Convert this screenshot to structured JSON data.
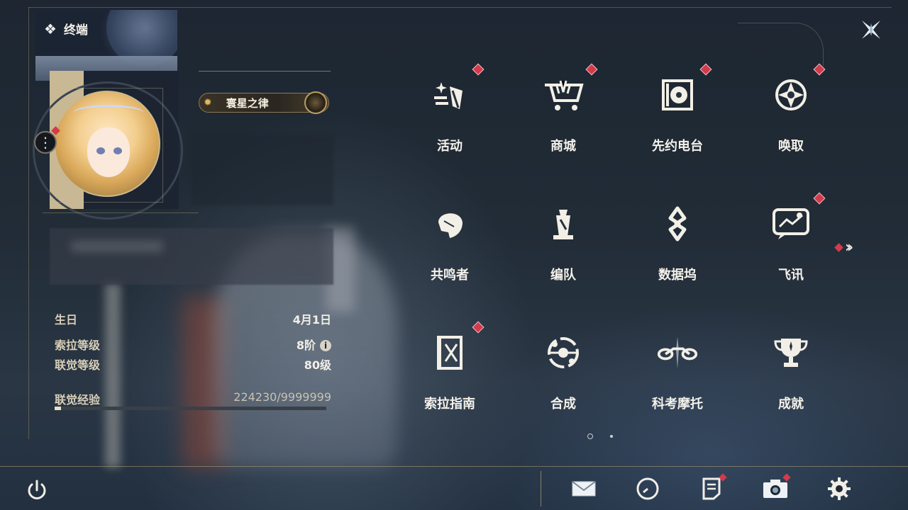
{
  "header": {
    "title": "终端"
  },
  "profile": {
    "title_badge": "寰星之律",
    "stats": [
      {
        "key": "生日",
        "value": "4月1日"
      },
      {
        "key": "索拉等级",
        "value": "8阶"
      },
      {
        "key": "联觉等级",
        "value": "80级"
      },
      {
        "key": "联觉经验",
        "value": "224230/9999999"
      }
    ],
    "exp_progress": 0.0224
  },
  "menu": {
    "items": [
      {
        "label": "活动",
        "icon": "activity-icon",
        "notif": true
      },
      {
        "label": "商城",
        "icon": "shop-icon",
        "notif": true
      },
      {
        "label": "先约电台",
        "icon": "radio-icon",
        "notif": true
      },
      {
        "label": "唤取",
        "icon": "summon-icon",
        "notif": true
      },
      {
        "label": "共鸣者",
        "icon": "resonator-icon",
        "notif": false
      },
      {
        "label": "编队",
        "icon": "team-icon",
        "notif": false
      },
      {
        "label": "数据坞",
        "icon": "data-bank-icon",
        "notif": false
      },
      {
        "label": "飞讯",
        "icon": "messages-icon",
        "notif": true
      },
      {
        "label": "索拉指南",
        "icon": "guidebook-icon",
        "notif": true
      },
      {
        "label": "合成",
        "icon": "synthesis-icon",
        "notif": false
      },
      {
        "label": "科考摩托",
        "icon": "motorcycle-icon",
        "notif": false
      },
      {
        "label": "成就",
        "icon": "trophy-icon",
        "notif": false
      }
    ],
    "current_page": 1,
    "pages": 2
  },
  "bottom_bar": {
    "buttons": [
      {
        "icon": "mail-icon",
        "notif": false
      },
      {
        "icon": "clock-icon",
        "notif": false
      },
      {
        "icon": "notes-icon",
        "notif": true
      },
      {
        "icon": "camera-icon",
        "notif": true
      },
      {
        "icon": "settings-icon",
        "notif": false
      }
    ]
  },
  "colors": {
    "accent_gold": "#c8b894",
    "notif_red": "#d23b4c",
    "bg": "#212c37"
  }
}
